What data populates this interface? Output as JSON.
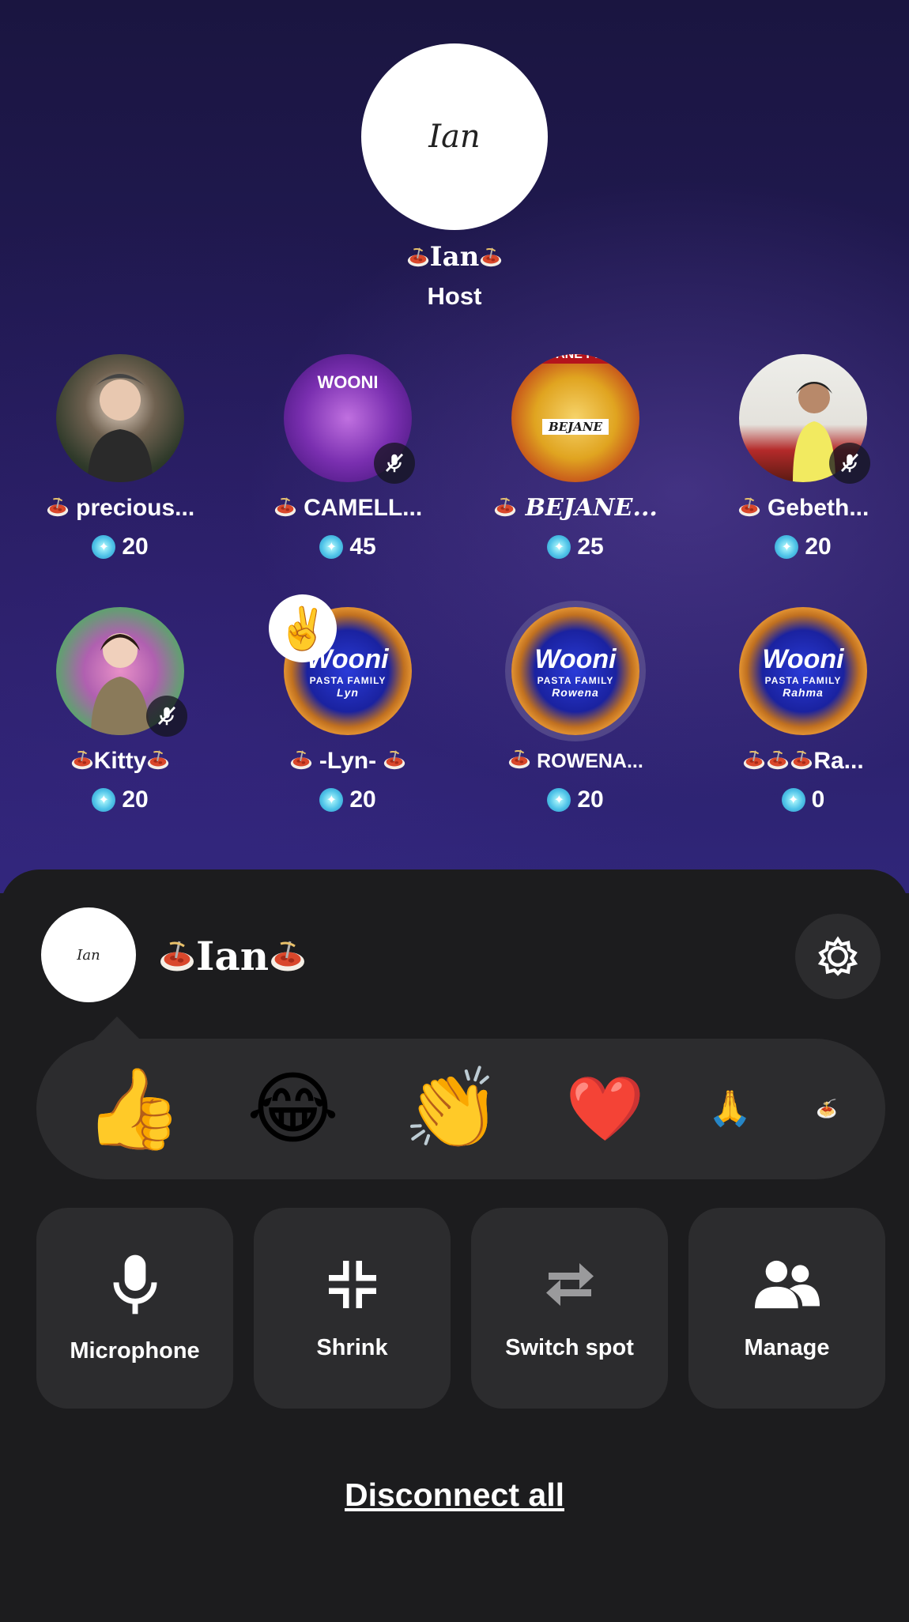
{
  "host": {
    "avatar_text": "Ian",
    "name": "Ian",
    "role": "Host"
  },
  "seats": [
    {
      "name": "precious...",
      "score": "20",
      "muted": false
    },
    {
      "name": "CAMELL...",
      "score": "45",
      "muted": true
    },
    {
      "name": "BEJANE...",
      "score": "25",
      "muted": false
    },
    {
      "name": "Gebeth...",
      "score": "20",
      "muted": true
    },
    {
      "name": "Kitty",
      "score": "20",
      "muted": true
    },
    {
      "name": "-Lyn-",
      "score": "20",
      "muted": false
    },
    {
      "name": "ROWENA...",
      "score": "20",
      "muted": false
    },
    {
      "name": "Ra...",
      "score": "0",
      "muted": false
    }
  ],
  "wooni": {
    "brand": "Wooni",
    "sub": "PASTA FAMILY",
    "lyn_tag": "Lyn",
    "rowena_tag": "Rowena",
    "rahma_tag": "Rahma"
  },
  "camell_banner": "WOONI",
  "bejane_banner": "BEJANE Pasta",
  "bejane_tag": "BEJANE",
  "me": {
    "avatar_text": "Ian",
    "name": "Ian"
  },
  "reactions": [
    "👍",
    "😂",
    "👏",
    "❤️",
    "🙏",
    "🍝"
  ],
  "actions": {
    "microphone": "Microphone",
    "shrink": "Shrink",
    "switch_spot": "Switch spot",
    "manage": "Manage"
  },
  "disconnect_label": "Disconnect all",
  "reaction_badge": "✌️",
  "colors": {
    "stage_bg": "#221a55",
    "sheet_bg": "#1c1c1e",
    "card_bg": "#2c2c2e",
    "coin": "#4fc3e8"
  }
}
